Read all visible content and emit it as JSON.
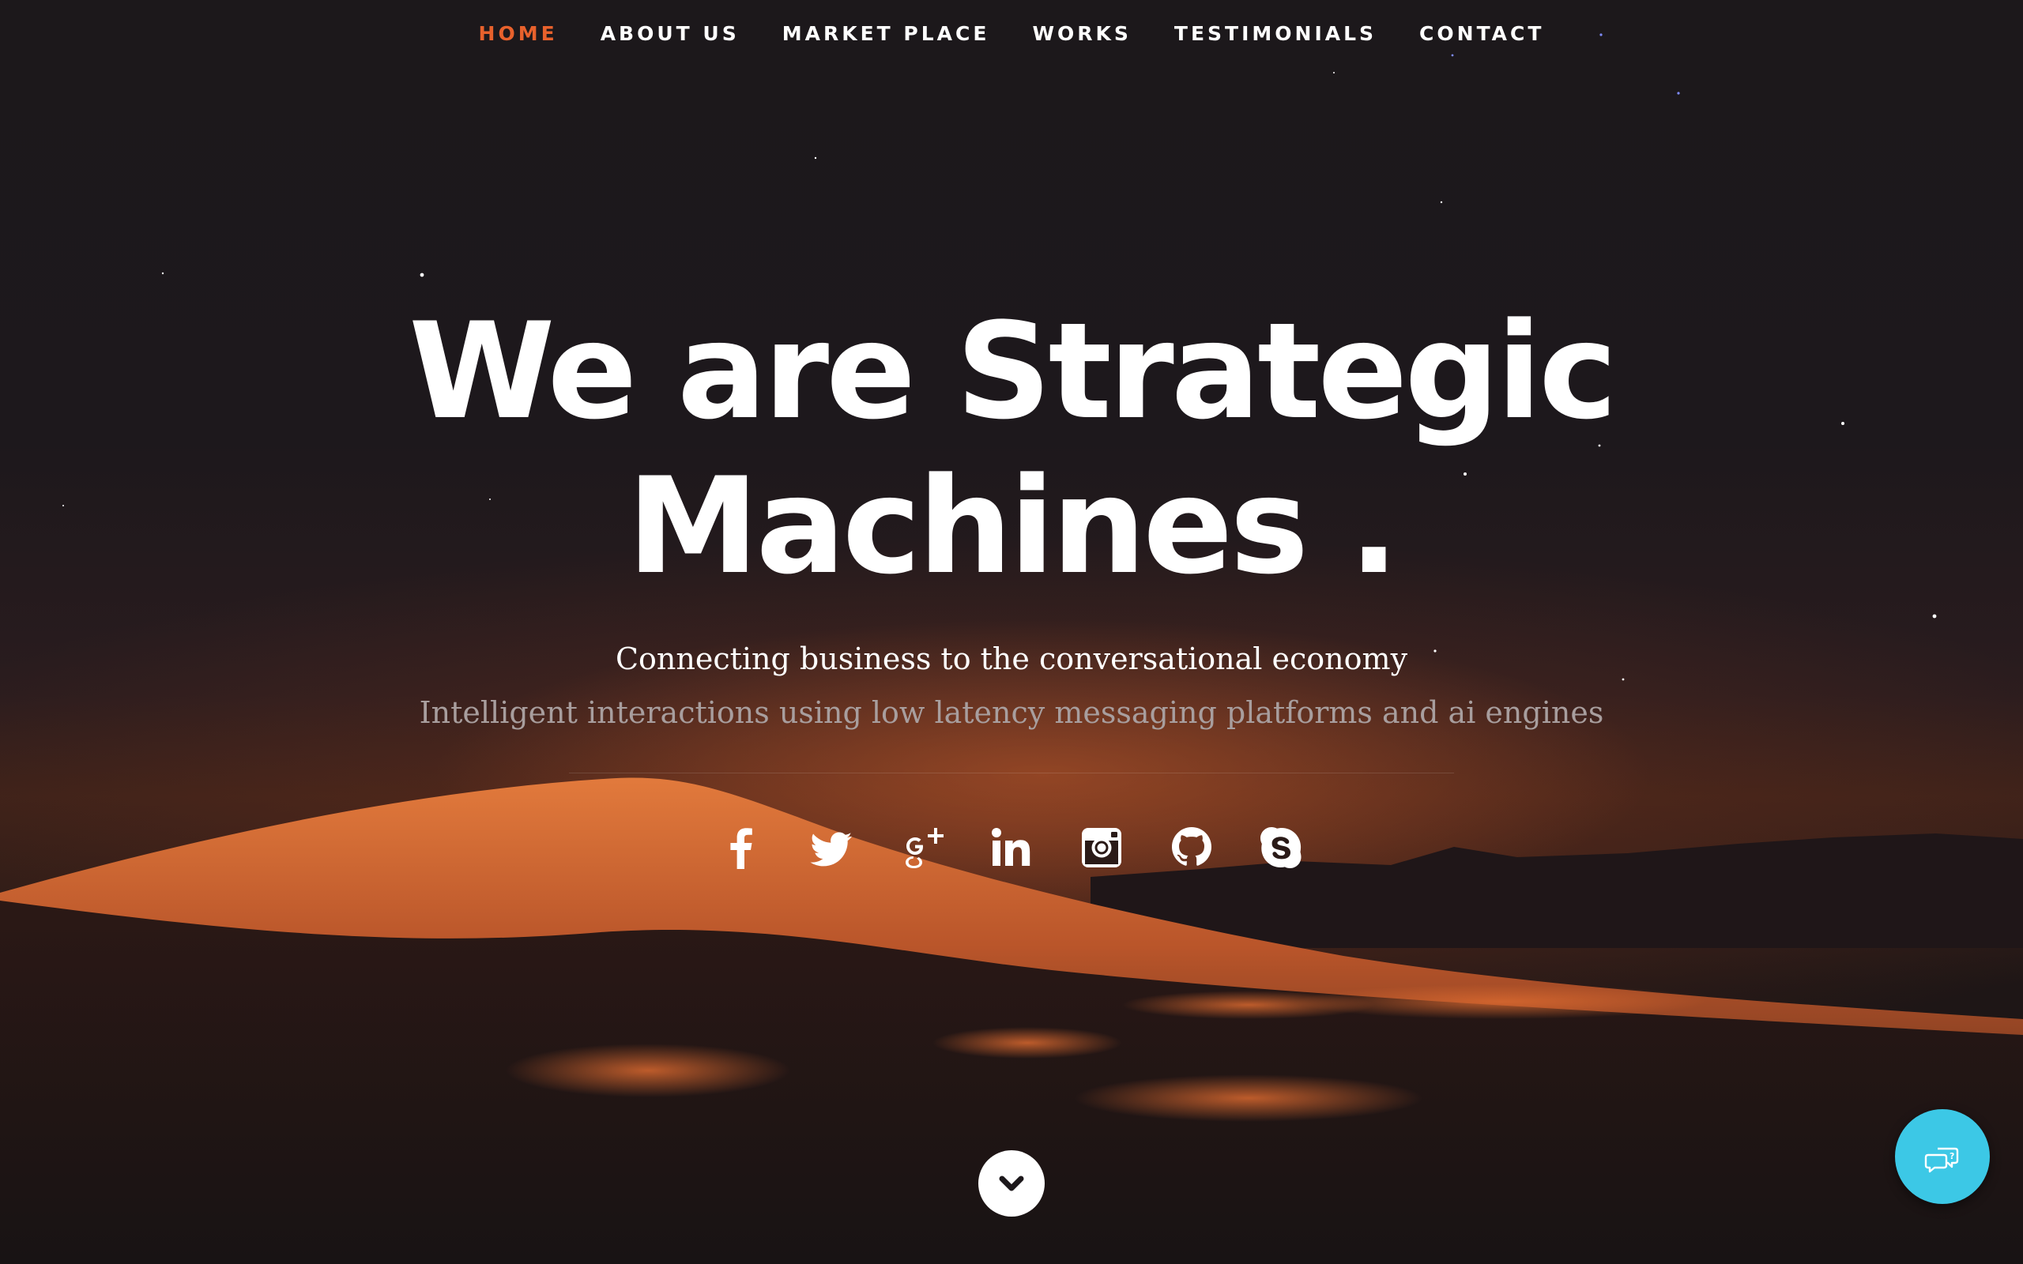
{
  "nav": {
    "items": [
      {
        "label": "HOME",
        "active": true
      },
      {
        "label": "ABOUT US",
        "active": false
      },
      {
        "label": "MARKET PLACE",
        "active": false
      },
      {
        "label": "WORKS",
        "active": false
      },
      {
        "label": "TESTIMONIALS",
        "active": false
      },
      {
        "label": "CONTACT",
        "active": false
      }
    ]
  },
  "hero": {
    "title_line1": "We are Strategic",
    "title_line2": "Machines .",
    "subtitle": "Connecting business to the conversational economy",
    "description": "Intelligent interactions using low latency messaging platforms and ai engines"
  },
  "social": {
    "icons": [
      "facebook-icon",
      "twitter-icon",
      "google-plus-icon",
      "linkedin-icon",
      "instagram-icon",
      "github-icon",
      "skype-icon"
    ]
  },
  "scroll_down": {
    "icon": "chevron-down-icon"
  },
  "chat_widget": {
    "icon": "chat-bubbles-icon"
  },
  "colors": {
    "accent": "#e8612c",
    "background": "#1c181b",
    "chat_widget": "#3cc8e6",
    "muted_text": "#a89e9e"
  }
}
